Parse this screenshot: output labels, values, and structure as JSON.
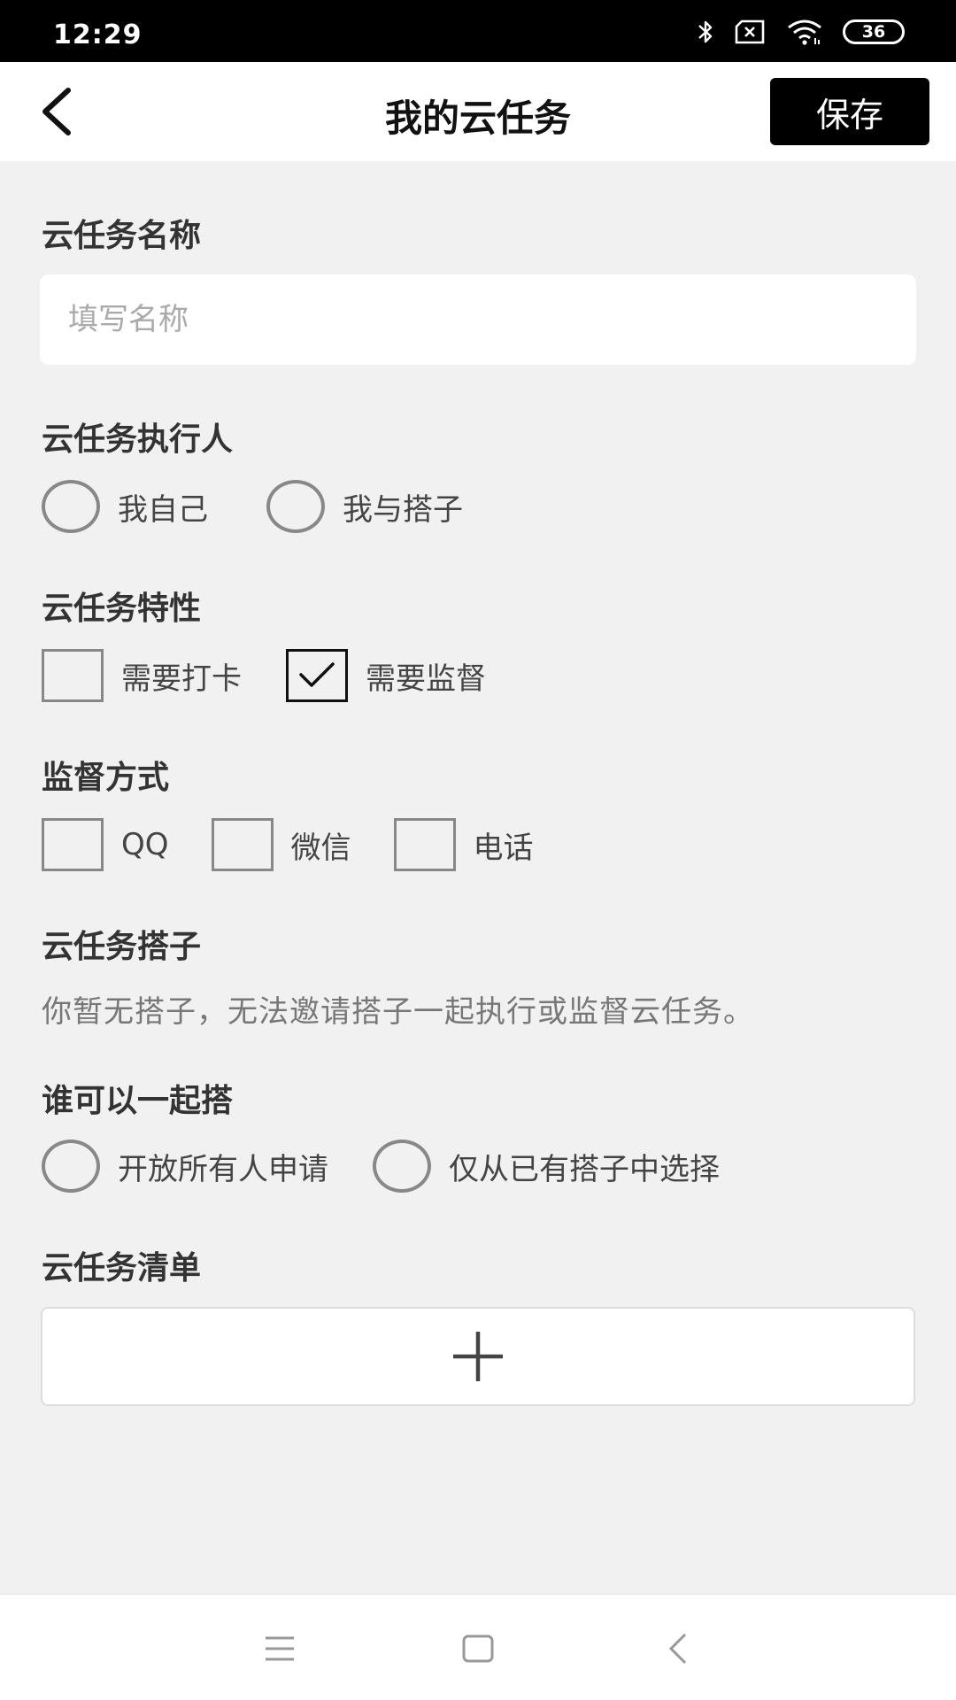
{
  "status_bar": {
    "time": "12:29",
    "battery": "36",
    "icons": [
      "bluetooth-icon",
      "sim-off-icon",
      "wifi-icon",
      "battery-icon"
    ]
  },
  "app_bar": {
    "title": "我的云任务",
    "save_label": "保存",
    "back_icon": "chevron-left-icon"
  },
  "name_section": {
    "label": "云任务名称",
    "placeholder": "填写名称",
    "value": ""
  },
  "executor_section": {
    "label": "云任务执行人",
    "options": [
      {
        "label": "我自己",
        "selected": false
      },
      {
        "label": "我与搭子",
        "selected": false
      }
    ]
  },
  "feature_section": {
    "label": "云任务特性",
    "options": [
      {
        "label": "需要打卡",
        "checked": false
      },
      {
        "label": "需要监督",
        "checked": true
      }
    ]
  },
  "supervise_section": {
    "label": "监督方式",
    "options": [
      {
        "label": "QQ",
        "checked": false
      },
      {
        "label": "微信",
        "checked": false
      },
      {
        "label": "电话",
        "checked": false
      }
    ]
  },
  "partner_section": {
    "label": "云任务搭子",
    "note": "你暂无搭子，无法邀请搭子一起执行或监督云任务。"
  },
  "join_section": {
    "label": "谁可以一起搭",
    "options": [
      {
        "label": "开放所有人申请",
        "selected": false
      },
      {
        "label": "仅从已有搭子中选择",
        "selected": false
      }
    ]
  },
  "list_section": {
    "label": "云任务清单",
    "add_icon": "plus-icon"
  },
  "nav_bar": {
    "icons": [
      "menu-icon",
      "home-square-icon",
      "back-triangle-icon"
    ]
  },
  "colors": {
    "background": "#f1f1f1",
    "accent": "#000000",
    "status_bar": "#000000"
  }
}
